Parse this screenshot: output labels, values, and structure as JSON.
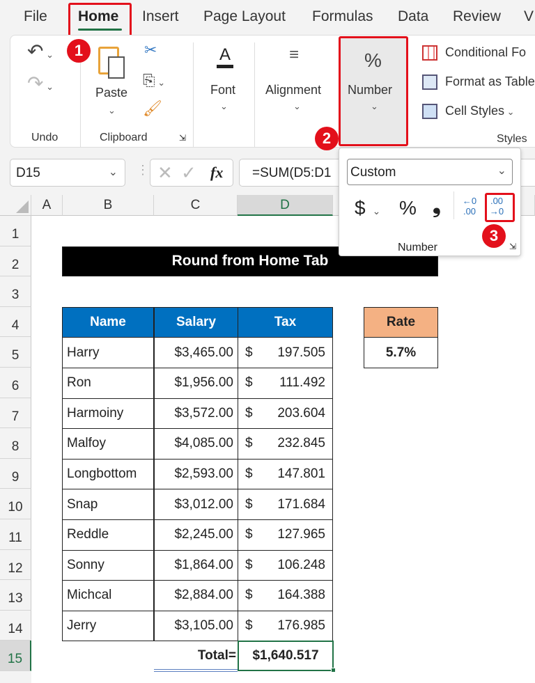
{
  "tabs": [
    "File",
    "Home",
    "Insert",
    "Page Layout",
    "Formulas",
    "Data",
    "Review",
    "V"
  ],
  "active_tab": "Home",
  "ribbon": {
    "undo_group": "Undo",
    "paste": "Paste",
    "clipboard_group": "Clipboard",
    "font": "Font",
    "alignment": "Alignment",
    "number": "Number",
    "conditional": "Conditional Fo",
    "format_table": "Format as Table",
    "cell_styles": "Cell Styles",
    "styles_group": "Styles"
  },
  "number_panel": {
    "format": "Custom",
    "dollar": "$",
    "percent": "%",
    "comma": "❟",
    "increase_decimal": "←0 .00",
    "decrease_decimal": ".00 →0",
    "label": "Number"
  },
  "formula_bar": {
    "name_box": "D15",
    "fx": "fx",
    "formula": "=SUM(D5:D1"
  },
  "badges": [
    "1",
    "2",
    "3"
  ],
  "columns": [
    "A",
    "B",
    "C",
    "D"
  ],
  "rows": [
    "1",
    "2",
    "3",
    "4",
    "5",
    "6",
    "7",
    "8",
    "9",
    "10",
    "11",
    "12",
    "13",
    "14",
    "15"
  ],
  "sheet": {
    "title": "Round from Home Tab",
    "headers": [
      "Name",
      "Salary",
      "Tax"
    ],
    "data": [
      [
        "Harry",
        "$3,465.00",
        "197.505"
      ],
      [
        "Ron",
        "$1,956.00",
        "111.492"
      ],
      [
        "Harmoiny",
        "$3,572.00",
        "203.604"
      ],
      [
        "Malfoy",
        "$4,085.00",
        "232.845"
      ],
      [
        "Longbottom",
        "$2,593.00",
        "147.801"
      ],
      [
        "Snap",
        "$3,012.00",
        "171.684"
      ],
      [
        "Reddle",
        "$2,245.00",
        "127.965"
      ],
      [
        "Sonny",
        "$1,864.00",
        "106.248"
      ],
      [
        "Michcal",
        "$2,884.00",
        "164.388"
      ],
      [
        "Jerry",
        "$3,105.00",
        "176.985"
      ]
    ],
    "currency_symbol": "$",
    "total_label": "Total=",
    "total_value": "$1,640.517",
    "rate_label": "Rate",
    "rate_value": "5.7%"
  },
  "colors": {
    "accent_red": "#e3101b",
    "header_blue": "#0070c0",
    "rate_orange": "#f4b183",
    "excel_green": "#217346"
  }
}
